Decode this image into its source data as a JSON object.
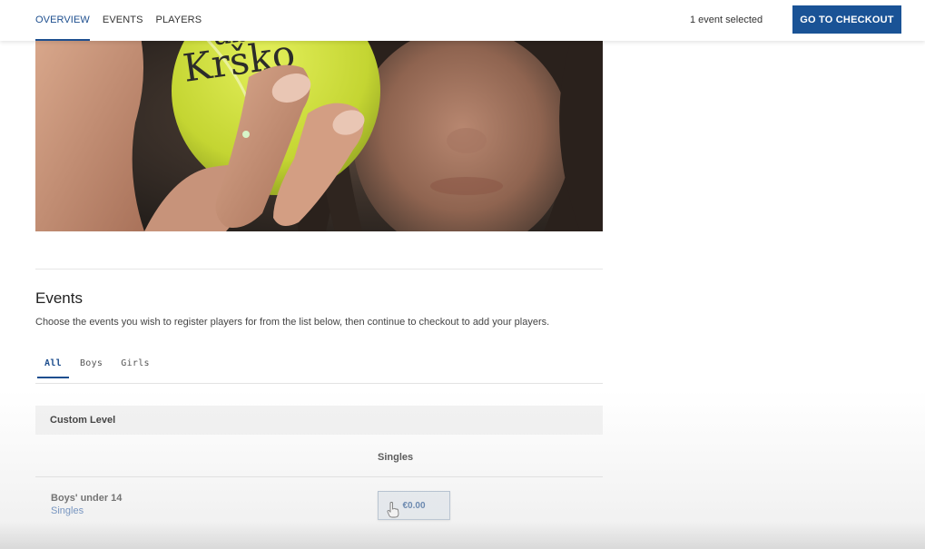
{
  "nav": {
    "items": [
      {
        "label": "OVERVIEW",
        "active": true
      },
      {
        "label": "EVENTS",
        "active": false
      },
      {
        "label": "PLAYERS",
        "active": false
      }
    ],
    "selected_count": "1 event selected",
    "checkout_label": "GO TO CHECKOUT"
  },
  "hero": {
    "ball_text": "Krško",
    "ball_text_top": "ub"
  },
  "events": {
    "title": "Events",
    "description": "Choose the events you wish to register players for from the list below, then continue to checkout to add your players.",
    "tabs": [
      {
        "label": "All",
        "active": true
      },
      {
        "label": "Boys",
        "active": false
      },
      {
        "label": "Girls",
        "active": false
      }
    ],
    "group": "Custom Level",
    "column": "Singles",
    "rows": [
      {
        "name": "Boys' under 14",
        "type": "Singles",
        "price": "€0.00"
      }
    ]
  },
  "colors": {
    "accent": "#1a5396",
    "link": "#2a5ea8",
    "ball": "#c9dc3a"
  }
}
